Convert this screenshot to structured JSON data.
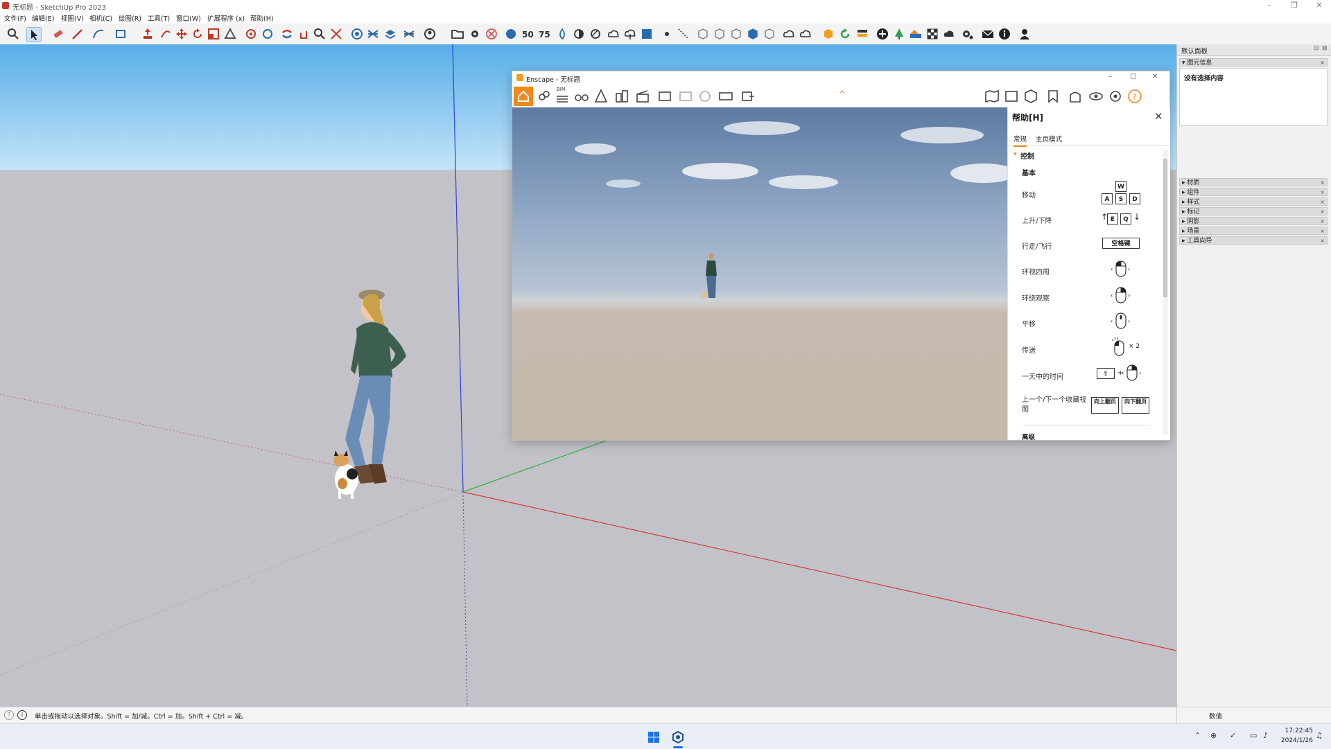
{
  "window": {
    "title": "无标题 - SketchUp Pro 2023"
  },
  "menu": [
    "文件(F)",
    "编辑(E)",
    "视图(V)",
    "相机(C)",
    "绘图(R)",
    "工具(T)",
    "窗口(W)",
    "扩展程序 (x)",
    "帮助(H)"
  ],
  "enscape": {
    "title": "Enscape - 无标题",
    "bim_label": "BIM",
    "help": {
      "title": "帮助[H]",
      "tabs": [
        "常规",
        "主页模式"
      ],
      "section": "控制",
      "subsection": "基本",
      "rows": [
        "移动",
        "上升/下降",
        "行走/飞行",
        "环视四周",
        "环绕观察",
        "平移",
        "传送",
        "一天中的时间",
        "上一个/下一个收藏视图"
      ],
      "keys": {
        "w": "W",
        "a": "A",
        "s": "S",
        "d": "D",
        "e": "E",
        "q": "Q",
        "space": "空格键",
        "pgup": "向上翻页",
        "pgdn": "向下翻页",
        "times2": "× 2",
        "plus": "+"
      },
      "next_section": "高级"
    }
  },
  "tray": {
    "title": "默认面板",
    "entity_info": "图元信息",
    "no_selection": "没有选择内容",
    "panels": [
      "材质",
      "组件",
      "样式",
      "标记",
      "阴影",
      "场景",
      "工具向导"
    ]
  },
  "status": {
    "hint": "单击或拖动以选择对象。Shift = 加/减。Ctrl = 加。Shift + Ctrl = 减。",
    "measurements_label": "数值"
  },
  "taskbar": {
    "time": "17:22:45",
    "date": "2024/1/26"
  }
}
